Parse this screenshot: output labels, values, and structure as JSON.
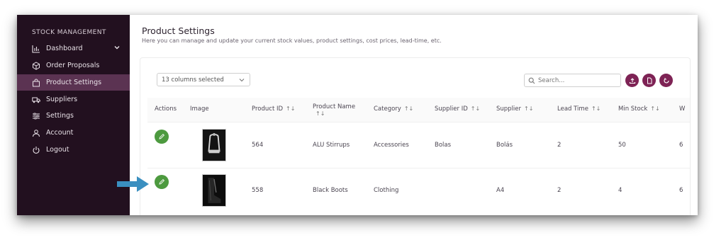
{
  "sidebar": {
    "heading": "STOCK MANAGEMENT",
    "items": [
      {
        "label": "Dashboard",
        "icon": "bar-chart-icon",
        "has_chevron": true
      },
      {
        "label": "Order Proposals",
        "icon": "cube-icon"
      },
      {
        "label": "Product Settings",
        "icon": "shopping-bag-icon",
        "active": true
      },
      {
        "label": "Suppliers",
        "icon": "truck-icon"
      },
      {
        "label": "Settings",
        "icon": "sliders-icon"
      },
      {
        "label": "Account",
        "icon": "user-icon"
      },
      {
        "label": "Logout",
        "icon": "power-icon"
      }
    ]
  },
  "header": {
    "title": "Product Settings",
    "subtitle": "Here you can manage and update your current stock values, product settings, cost prices, lead-time, etc."
  },
  "toolbar": {
    "columns_selected": "13 columns selected",
    "search_placeholder": "Search...",
    "buttons": [
      "upload-icon",
      "file-icon",
      "refresh-icon"
    ]
  },
  "table": {
    "columns": [
      "Actions",
      "Image",
      "Product ID",
      "Product Name",
      "Category",
      "Supplier ID",
      "Supplier",
      "Lead Time",
      "Min Stock",
      "W"
    ],
    "rows": [
      {
        "product_id": "564",
        "product_name": "ALU Stirrups",
        "category": "Accessories",
        "supplier_id": "Bolas",
        "supplier": "Bolás",
        "lead_time": "2",
        "min_stock": "50",
        "extra": "6"
      },
      {
        "product_id": "558",
        "product_name": "Black Boots",
        "category": "Clothing",
        "supplier_id": "",
        "supplier": "A4",
        "lead_time": "2",
        "min_stock": "4",
        "extra": "6"
      }
    ]
  },
  "colors": {
    "sidebar_bg": "#22101f",
    "active_item": "#5b3352",
    "accent_button": "#7e2355",
    "edit_button": "#4d9a3f",
    "arrow": "#3a8fc0"
  }
}
